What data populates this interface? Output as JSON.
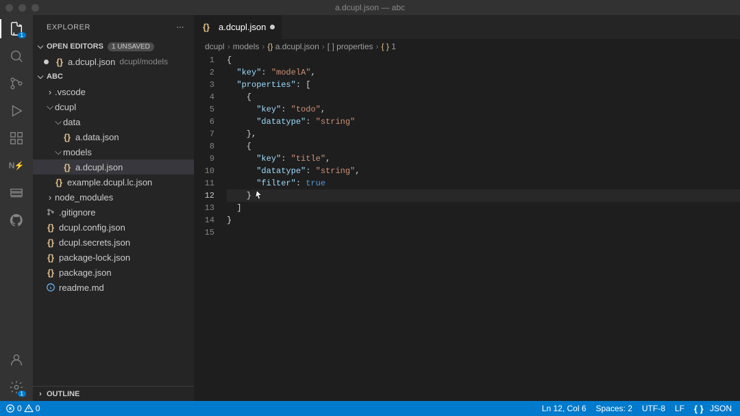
{
  "window": {
    "title": "a.dcupl.json — abc"
  },
  "sidebar": {
    "title": "EXPLORER",
    "openEditors": {
      "label": "OPEN EDITORS",
      "badge": "1 UNSAVED"
    },
    "openFile": {
      "name": "a.dcupl.json",
      "dir": "dcupl/models"
    },
    "project": "ABC",
    "tree": [
      {
        "icon": "chev-right",
        "label": ".vscode",
        "indent": 1
      },
      {
        "icon": "chev-down",
        "label": "dcupl",
        "indent": 1
      },
      {
        "icon": "chev-down",
        "label": "data",
        "indent": 2
      },
      {
        "icon": "braces",
        "label": "a.data.json",
        "indent": 3
      },
      {
        "icon": "chev-down",
        "label": "models",
        "indent": 2
      },
      {
        "icon": "braces",
        "label": "a.dcupl.json",
        "indent": 3,
        "selected": true
      },
      {
        "icon": "braces",
        "label": "example.dcupl.lc.json",
        "indent": 2
      },
      {
        "icon": "chev-right",
        "label": "node_modules",
        "indent": 1
      },
      {
        "icon": "git",
        "label": ".gitignore",
        "indent": 1
      },
      {
        "icon": "braces",
        "label": "dcupl.config.json",
        "indent": 1
      },
      {
        "icon": "braces",
        "label": "dcupl.secrets.json",
        "indent": 1
      },
      {
        "icon": "braces",
        "label": "package-lock.json",
        "indent": 1
      },
      {
        "icon": "braces",
        "label": "package.json",
        "indent": 1
      },
      {
        "icon": "info",
        "label": "readme.md",
        "indent": 1
      }
    ],
    "outline": "OUTLINE"
  },
  "tab": {
    "name": "a.dcupl.json"
  },
  "breadcrumbs": [
    "dcupl",
    "models",
    "a.dcupl.json",
    "properties",
    "1"
  ],
  "code": [
    [
      [
        "punc",
        "{"
      ]
    ],
    [
      [
        "punc",
        "  "
      ],
      [
        "key",
        "\"key\""
      ],
      [
        "punc",
        ": "
      ],
      [
        "str",
        "\"modelA\""
      ],
      [
        "punc",
        ","
      ]
    ],
    [
      [
        "punc",
        "  "
      ],
      [
        "key",
        "\"properties\""
      ],
      [
        "punc",
        ": ["
      ]
    ],
    [
      [
        "punc",
        "    {"
      ]
    ],
    [
      [
        "punc",
        "      "
      ],
      [
        "key",
        "\"key\""
      ],
      [
        "punc",
        ": "
      ],
      [
        "str",
        "\"todo\""
      ],
      [
        "punc",
        ","
      ]
    ],
    [
      [
        "punc",
        "      "
      ],
      [
        "key",
        "\"datatype\""
      ],
      [
        "punc",
        ": "
      ],
      [
        "str",
        "\"string\""
      ]
    ],
    [
      [
        "punc",
        "    },"
      ]
    ],
    [
      [
        "punc",
        "    {"
      ]
    ],
    [
      [
        "punc",
        "      "
      ],
      [
        "key",
        "\"key\""
      ],
      [
        "punc",
        ": "
      ],
      [
        "str",
        "\"title\""
      ],
      [
        "punc",
        ","
      ]
    ],
    [
      [
        "punc",
        "      "
      ],
      [
        "key",
        "\"datatype\""
      ],
      [
        "punc",
        ": "
      ],
      [
        "str",
        "\"string\""
      ],
      [
        "punc",
        ","
      ]
    ],
    [
      [
        "punc",
        "      "
      ],
      [
        "key",
        "\"filter\""
      ],
      [
        "punc",
        ": "
      ],
      [
        "bool",
        "true"
      ]
    ],
    [
      [
        "punc",
        "    }"
      ]
    ],
    [
      [
        "punc",
        "  ]"
      ]
    ],
    [
      [
        "punc",
        "}"
      ]
    ],
    []
  ],
  "currentLine": 12,
  "status": {
    "errors": "0",
    "warnings": "0",
    "lncol": "Ln 12, Col 6",
    "spaces": "Spaces: 2",
    "encoding": "UTF-8",
    "eol": "LF",
    "lang": "JSON"
  }
}
